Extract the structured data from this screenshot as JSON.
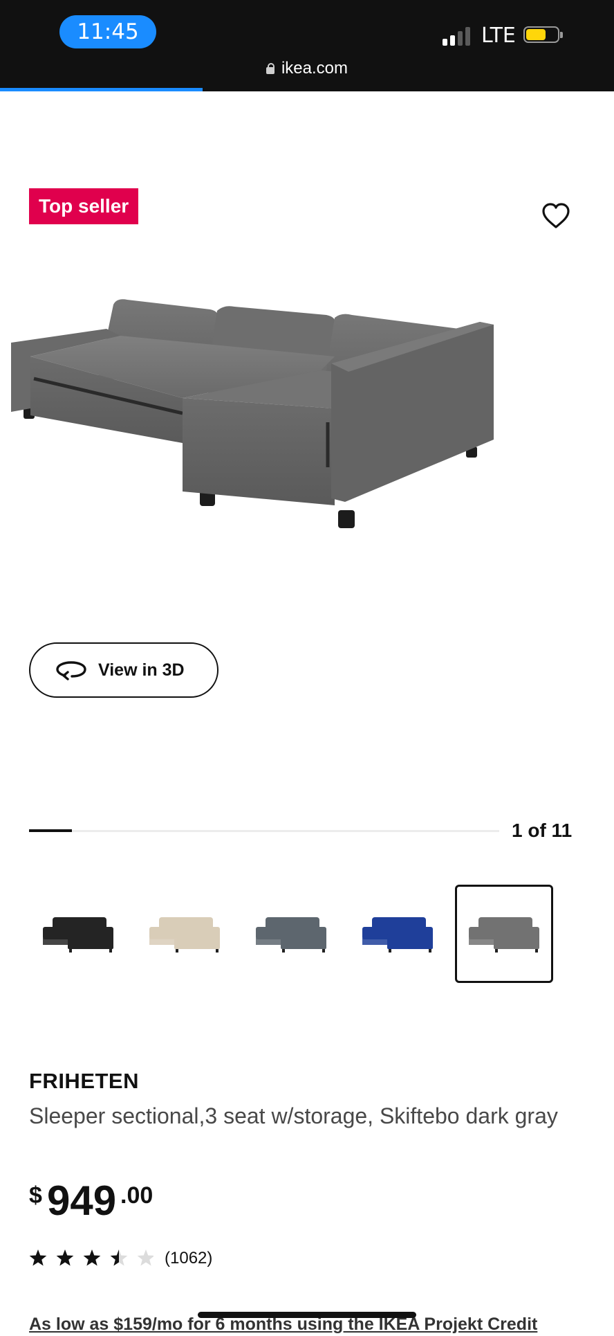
{
  "status_bar": {
    "time": "11:45",
    "network": "LTE",
    "signal_bars_active": 2,
    "signal_bars_total": 4,
    "battery_level": 0.5,
    "battery_color": "#ffd60a"
  },
  "browser": {
    "url": "ikea.com",
    "load_progress": 0.33,
    "accent_color": "#1a8cff"
  },
  "product_media": {
    "badge": "Top seller",
    "badge_color": "#e0004d",
    "favorite_icon": "heart-icon",
    "view_3d_label": "View in 3D",
    "view_3d_icon": "rotate-3d-icon",
    "image_index": 1,
    "image_count": 11,
    "counter_text": "1 of 11"
  },
  "swatches": [
    {
      "color": "#242424",
      "selected": false
    },
    {
      "color": "#d9cdb8",
      "selected": false
    },
    {
      "color": "#5d666e",
      "selected": false
    },
    {
      "color": "#1f3f9a",
      "selected": false
    },
    {
      "color": "#727272",
      "selected": true
    }
  ],
  "product": {
    "name": "FRIHETEN",
    "description": "Sleeper sectional,3 seat w/storage, Skiftebo dark gray",
    "price": {
      "currency": "$",
      "integer": "949",
      "decimal": ".00"
    },
    "rating": 3.5,
    "rating_max": 5,
    "review_count": "(1062)",
    "financing": "As low as $159/mo for 6 months using the IKEA Projekt Credit"
  }
}
